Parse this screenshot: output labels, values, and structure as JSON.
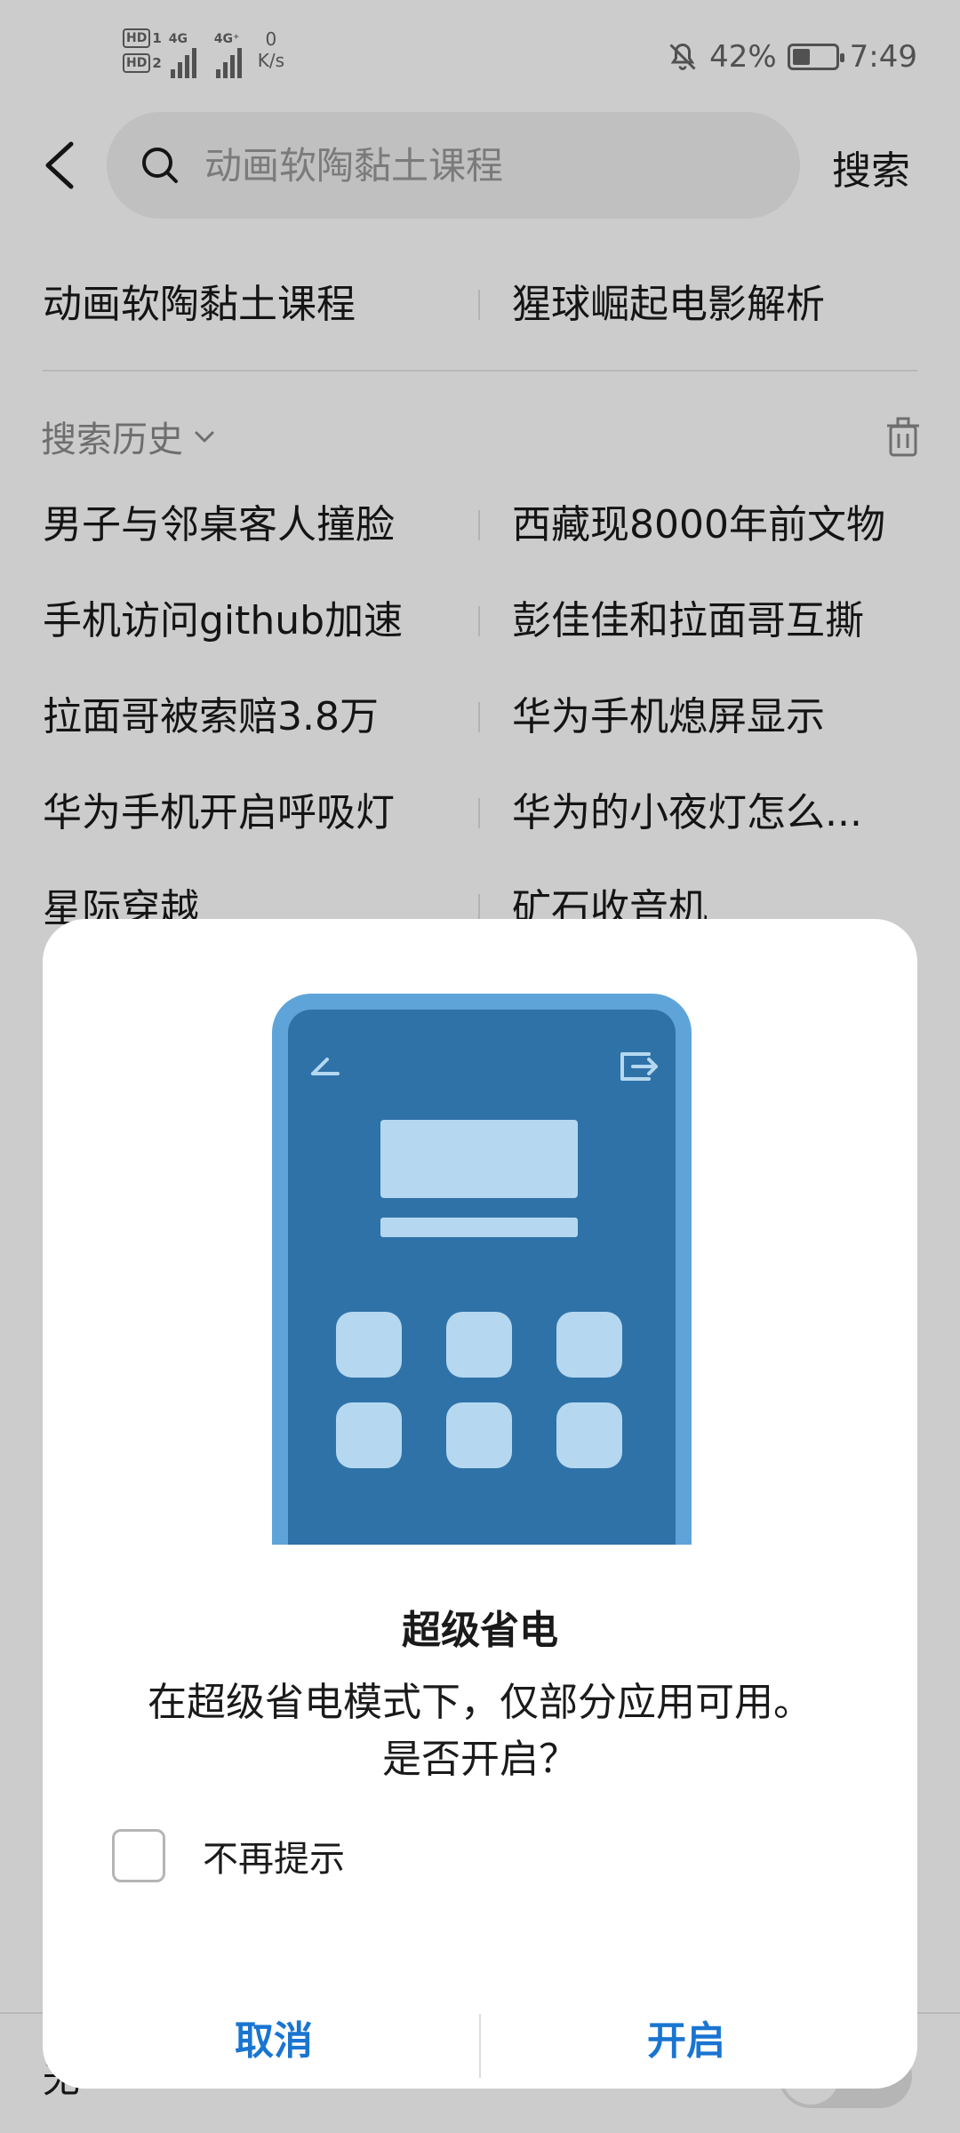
{
  "status_bar": {
    "hd1": "HD",
    "hd1_sim": "1",
    "hd2": "HD",
    "hd2_sim": "2",
    "net1": "4G",
    "net2": "4G⁺",
    "speed_value": "0",
    "speed_unit": "K/s",
    "battery_percent": "42%",
    "battery_level": 0.42,
    "time": "7:49",
    "icons": [
      "notifications-off-icon",
      "battery-icon"
    ]
  },
  "header": {
    "search_placeholder": "动画软陶黏土课程",
    "search_label": "搜索"
  },
  "suggestions": [
    {
      "left": "动画软陶黏土课程",
      "right": "猩球崛起电影解析"
    }
  ],
  "history": {
    "title": "搜索历史",
    "rows": [
      {
        "left": "男子与邻桌客人撞脸",
        "right": "西藏现8000年前文物"
      },
      {
        "left": "手机访问github加速",
        "right": "彭佳佳和拉面哥互撕"
      },
      {
        "left": "拉面哥被索赔3.8万",
        "right": "华为手机熄屏显示"
      },
      {
        "left": "华为手机开启呼吸灯",
        "right": "华为的小夜灯怎么..."
      },
      {
        "left": "星际穿越",
        "right": "矿石收音机"
      }
    ]
  },
  "bottom_row": {
    "label": "无",
    "toggle_on": false
  },
  "dialog": {
    "title": "超级省电",
    "message_line1": "在超级省电模式下，仅部分应用可用。",
    "message_line2": "是否开启？",
    "checkbox_label": "不再提示",
    "checkbox_checked": false,
    "cancel_label": "取消",
    "confirm_label": "开启",
    "accent_color": "#1a75d1"
  }
}
